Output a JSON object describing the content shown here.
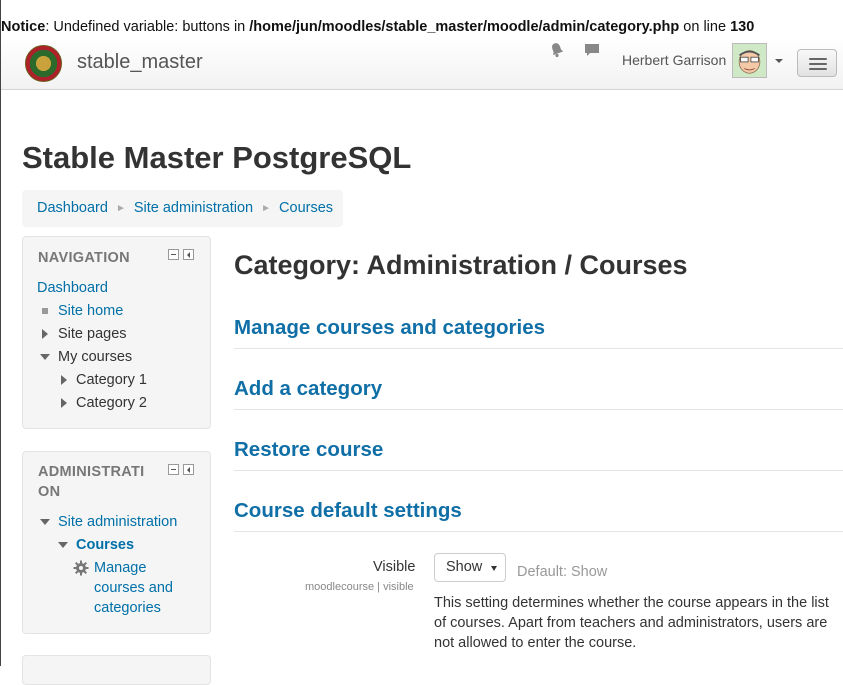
{
  "notice": {
    "label": "Notice",
    "message": ": Undefined variable: buttons in ",
    "path": "/home/jun/moodles/stable_master/moodle/admin/category.php",
    "mid": " on line ",
    "line": "130"
  },
  "navbar": {
    "brand": "stable_master",
    "username": "Herbert Garrison"
  },
  "page_heading": "Stable Master PostgreSQL",
  "breadcrumb": [
    "Dashboard",
    "Site administration",
    "Courses"
  ],
  "navigation_block": {
    "title": "NAVIGATION",
    "dashboard": "Dashboard",
    "site_home": "Site home",
    "site_pages": "Site pages",
    "my_courses": "My courses",
    "category1": "Category 1",
    "category2": "Category 2"
  },
  "admin_block": {
    "title_line1": "ADMINISTRATI",
    "title_line2": "ON",
    "site_admin": "Site administration",
    "courses": "Courses",
    "manage_line1": "Manage",
    "manage_line2": "courses and",
    "manage_line3": "categories"
  },
  "main": {
    "title": "Category: Administration / Courses",
    "sections": [
      "Manage courses and categories",
      "Add a category",
      "Restore course",
      "Course default settings"
    ],
    "setting": {
      "label": "Visible",
      "sublabel": "moodlecourse | visible",
      "selected": "Show",
      "default": "Default: Show",
      "description": "This setting determines whether the course appears in the list of courses. Apart from teachers and administrators, users are not allowed to enter the course."
    }
  },
  "colors": {
    "link": "#0070a8",
    "section_heading": "#0f6fa6"
  }
}
